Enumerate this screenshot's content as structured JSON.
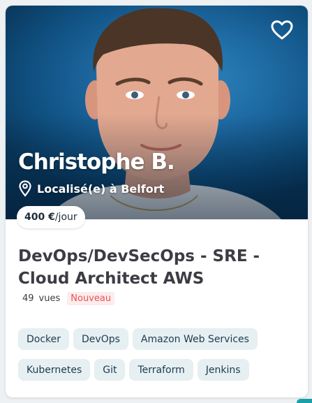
{
  "profile": {
    "name": "Christophe B.",
    "location": "Localisé(e) à Belfort",
    "price_amount": "400 €",
    "price_unit": "/jour",
    "favorite_icon": "heart-outline-icon",
    "location_icon": "map-pin-icon"
  },
  "mission": {
    "title": "DevOps/DevSecOps - SRE - Cloud Architect AWS",
    "views_count": "49",
    "views_label": "vues",
    "badge": "Nouveau"
  },
  "skills": {
    "row1": [
      "Docker",
      "DevOps",
      "Amazon Web Services"
    ],
    "row2": [
      "Kubernetes",
      "Git",
      "Terraform",
      "Jenkins"
    ]
  },
  "colors": {
    "tag_bg": "#e6eff2",
    "badge_text": "#e8535a",
    "badge_bg": "#fdecec",
    "title_text": "#3c3c44"
  }
}
